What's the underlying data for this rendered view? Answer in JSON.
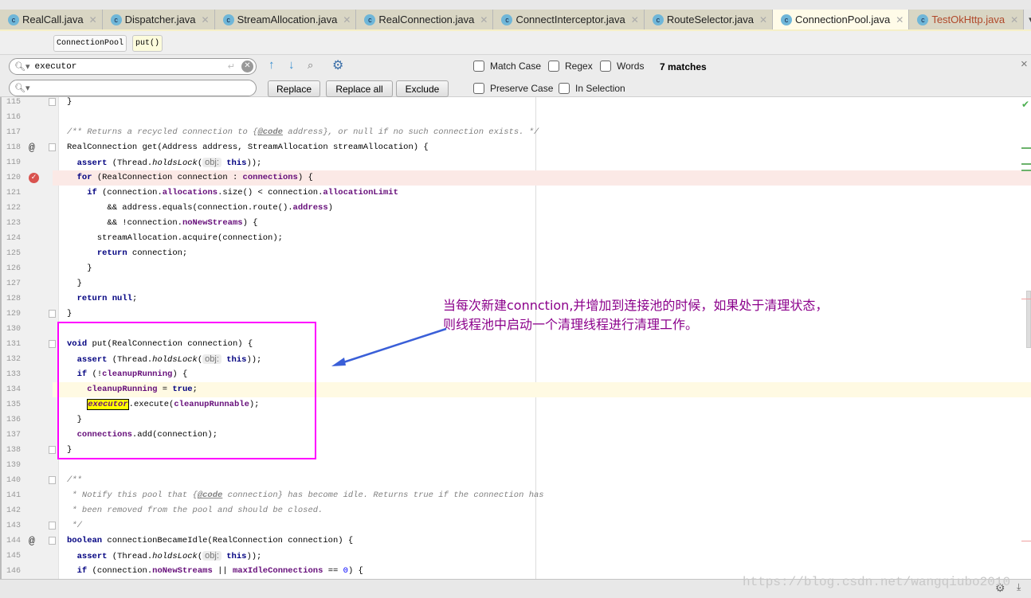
{
  "tabs": [
    {
      "label": "RealCall.java",
      "active": false
    },
    {
      "label": "Dispatcher.java",
      "active": false
    },
    {
      "label": "StreamAllocation.java",
      "active": false
    },
    {
      "label": "RealConnection.java",
      "active": false
    },
    {
      "label": "ConnectInterceptor.java",
      "active": false
    },
    {
      "label": "RouteSelector.java",
      "active": false
    },
    {
      "label": "ConnectionPool.java",
      "active": true
    },
    {
      "label": "TestOkHttp.java",
      "active": false
    }
  ],
  "tab_overflow": "▾≡2",
  "breadcrumb": {
    "class": "ConnectionPool",
    "method": "put()"
  },
  "find": {
    "search_value": "executor",
    "replace_value": "",
    "replace_label": "Replace",
    "replace_all_label": "Replace all",
    "exclude_label": "Exclude",
    "match_case": "Match Case",
    "regex": "Regex",
    "words": "Words",
    "preserve_case": "Preserve Case",
    "in_selection": "In Selection",
    "matches": "7 matches",
    "close": "×"
  },
  "code": [
    {
      "n": "115",
      "tokens": [
        [
          "}",
          ""
        ]
      ]
    },
    {
      "n": "116",
      "tokens": []
    },
    {
      "n": "117",
      "tokens": [
        [
          "/** Returns a recycled connection to {",
          "cm"
        ],
        [
          "@code",
          "cmb"
        ],
        [
          " address}, or null if no such connection exists. */",
          "cm"
        ]
      ]
    },
    {
      "n": "118",
      "marker": "@",
      "tokens": [
        [
          "RealConnection get(Address address, StreamAllocation streamAllocation) {",
          ""
        ]
      ]
    },
    {
      "n": "119",
      "tokens": [
        [
          "  ",
          ""
        ],
        [
          "assert",
          "kw"
        ],
        [
          " (Thread.",
          ""
        ],
        [
          "holdsLock",
          "it"
        ],
        [
          "(",
          ""
        ],
        [
          "obj:",
          "hint"
        ],
        [
          " ",
          ""
        ],
        [
          "this",
          "kw"
        ],
        [
          "));",
          ""
        ]
      ]
    },
    {
      "n": "120",
      "marker": "breakpoint",
      "tokens": [
        [
          "  ",
          ""
        ],
        [
          "for",
          "kw"
        ],
        [
          " (RealConnection connection : ",
          ""
        ],
        [
          "connections",
          "fld"
        ],
        [
          ") {",
          ""
        ]
      ]
    },
    {
      "n": "121",
      "tokens": [
        [
          "    ",
          ""
        ],
        [
          "if",
          "kw"
        ],
        [
          " (connection.",
          ""
        ],
        [
          "allocations",
          "fld"
        ],
        [
          ".size() < connection.",
          ""
        ],
        [
          "allocationLimit",
          "fld"
        ]
      ]
    },
    {
      "n": "122",
      "tokens": [
        [
          "        && address.equals(connection.route().",
          ""
        ],
        [
          "address",
          "fld"
        ],
        [
          ")",
          ""
        ]
      ]
    },
    {
      "n": "123",
      "tokens": [
        [
          "        && !connection.",
          ""
        ],
        [
          "noNewStreams",
          "fld"
        ],
        [
          ") {",
          ""
        ]
      ]
    },
    {
      "n": "124",
      "tokens": [
        [
          "      streamAllocation.acquire(connection);",
          ""
        ]
      ]
    },
    {
      "n": "125",
      "tokens": [
        [
          "      ",
          ""
        ],
        [
          "return",
          "kw"
        ],
        [
          " connection;",
          ""
        ]
      ]
    },
    {
      "n": "126",
      "tokens": [
        [
          "    }",
          ""
        ]
      ]
    },
    {
      "n": "127",
      "tokens": [
        [
          "  }",
          ""
        ]
      ]
    },
    {
      "n": "128",
      "tokens": [
        [
          "  ",
          ""
        ],
        [
          "return",
          "kw"
        ],
        [
          " ",
          ""
        ],
        [
          "null",
          "kw"
        ],
        [
          ";",
          ""
        ]
      ]
    },
    {
      "n": "129",
      "tokens": [
        [
          "}",
          ""
        ]
      ]
    },
    {
      "n": "130",
      "tokens": []
    },
    {
      "n": "131",
      "tokens": [
        [
          "void",
          "kw"
        ],
        [
          " put(RealConnection connection) {",
          ""
        ]
      ]
    },
    {
      "n": "132",
      "tokens": [
        [
          "  ",
          ""
        ],
        [
          "assert",
          "kw"
        ],
        [
          " (Thread.",
          ""
        ],
        [
          "holdsLock",
          "it"
        ],
        [
          "(",
          ""
        ],
        [
          "obj:",
          "hint"
        ],
        [
          " ",
          ""
        ],
        [
          "this",
          "kw"
        ],
        [
          "));",
          ""
        ]
      ]
    },
    {
      "n": "133",
      "tokens": [
        [
          "  ",
          ""
        ],
        [
          "if",
          "kw"
        ],
        [
          " (!",
          ""
        ],
        [
          "cleanupRunning",
          "fld"
        ],
        [
          ") {",
          ""
        ]
      ]
    },
    {
      "n": "134",
      "tokens": [
        [
          "    ",
          ""
        ],
        [
          "cleanupRunning",
          "fld"
        ],
        [
          " = ",
          ""
        ],
        [
          "true",
          "kw"
        ],
        [
          ";",
          ""
        ]
      ]
    },
    {
      "n": "135",
      "tokens": [
        [
          "    ",
          ""
        ],
        [
          "executor",
          "hit"
        ],
        [
          ".execute(",
          ""
        ],
        [
          "cleanupRunnable",
          "fld"
        ],
        [
          ");",
          ""
        ]
      ]
    },
    {
      "n": "136",
      "tokens": [
        [
          "  }",
          ""
        ]
      ]
    },
    {
      "n": "137",
      "tokens": [
        [
          "  ",
          ""
        ],
        [
          "connections",
          "fld"
        ],
        [
          ".add(connection);",
          ""
        ]
      ]
    },
    {
      "n": "138",
      "tokens": [
        [
          "}",
          ""
        ]
      ]
    },
    {
      "n": "139",
      "tokens": []
    },
    {
      "n": "140",
      "tokens": [
        [
          "/**",
          "cm"
        ]
      ]
    },
    {
      "n": "141",
      "tokens": [
        [
          " * Notify this pool that {",
          "cm"
        ],
        [
          "@code",
          "cmb"
        ],
        [
          " connection} has become idle. Returns true if the connection has",
          "cm"
        ]
      ]
    },
    {
      "n": "142",
      "tokens": [
        [
          " * been removed from the pool and should be closed.",
          "cm"
        ]
      ]
    },
    {
      "n": "143",
      "tokens": [
        [
          " */",
          "cm"
        ]
      ]
    },
    {
      "n": "144",
      "marker": "@",
      "tokens": [
        [
          "boolean",
          "kw"
        ],
        [
          " connectionBecameIdle(RealConnection connection) {",
          ""
        ]
      ]
    },
    {
      "n": "145",
      "tokens": [
        [
          "  ",
          ""
        ],
        [
          "assert",
          "kw"
        ],
        [
          " (Thread.",
          ""
        ],
        [
          "holdsLock",
          "it"
        ],
        [
          "(",
          ""
        ],
        [
          "obj:",
          "hint"
        ],
        [
          " ",
          ""
        ],
        [
          "this",
          "kw"
        ],
        [
          "));",
          ""
        ]
      ]
    },
    {
      "n": "146",
      "tokens": [
        [
          "  ",
          ""
        ],
        [
          "if",
          "kw"
        ],
        [
          " (connection.",
          ""
        ],
        [
          "noNewStreams",
          "fld"
        ],
        [
          " || ",
          ""
        ],
        [
          "maxIdleConnections",
          "fld"
        ],
        [
          " == ",
          ""
        ],
        [
          "0",
          "num"
        ],
        [
          ") {",
          ""
        ]
      ]
    }
  ],
  "annotation": {
    "line1": "当每次新建connction,并增加到连接池的时候，如果处于清理状态，",
    "line2": "则线程池中启动一个清理线程进行清理工作。",
    "color": "#8b008b",
    "box_color": "#ff00ff",
    "arrow_color": "#3a5fd8"
  },
  "watermark": "https://blog.csdn.net/wangqiubo2010"
}
